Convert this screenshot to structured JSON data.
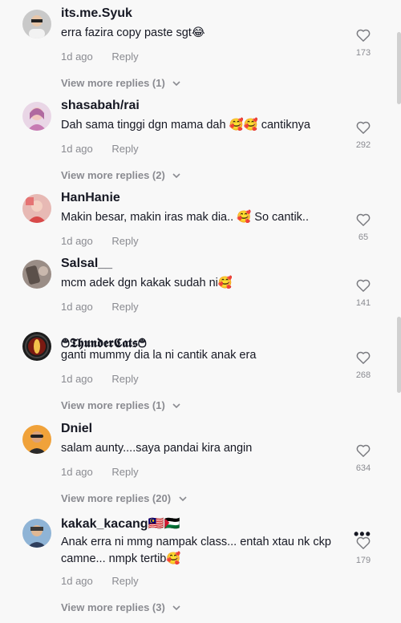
{
  "comments": [
    {
      "username": "its.me.Syuk",
      "text": "erra fazira copy paste sgt😂",
      "time": "1d ago",
      "reply_label": "Reply",
      "likes": "173",
      "view_more": "View more replies (1)"
    },
    {
      "username": "shasabah/rai",
      "text": "Dah sama tinggi dgn mama dah 🥰🥰 cantiknya",
      "time": "1d ago",
      "reply_label": "Reply",
      "likes": "292",
      "view_more": "View more replies (2)"
    },
    {
      "username": "HanHanie",
      "text": "Makin besar, makin iras mak dia.. 🥰 So cantik..",
      "time": "1d ago",
      "reply_label": "Reply",
      "likes": "65",
      "view_more": ""
    },
    {
      "username": "Salsal__",
      "text": "mcm adek dgn kakak sudah ni🥰",
      "time": "1d ago",
      "reply_label": "Reply",
      "likes": "141",
      "view_more": ""
    },
    {
      "username": "࿉𝕿𝖍𝖚𝖓𝖉𝖊𝖗𝕮𝖆𝖙𝖘࿉",
      "text": "ganti mummy dia la ni cantik anak era",
      "time": "1d ago",
      "reply_label": "Reply",
      "likes": "268",
      "view_more": "View more replies (1)"
    },
    {
      "username": "Dniel",
      "text": "salam aunty....saya pandai kira angin",
      "time": "1d ago",
      "reply_label": "Reply",
      "likes": "634",
      "view_more": "View more replies (20)"
    },
    {
      "username": "kakak_kacang🇲🇾🇵🇸",
      "text": "Anak erra ni mmg nampak class... entah xtau nk ckp camne... nmpk tertib🥰",
      "time": "1d ago",
      "reply_label": "Reply",
      "likes": "179",
      "view_more": "View more replies (3)"
    }
  ],
  "icons": {
    "like": "heart-outline-icon",
    "expand": "chevron-down-icon",
    "more": "more-dots-icon"
  },
  "more_dots": "•••",
  "colors": {
    "text": "#161823",
    "muted": "#8a8b91",
    "background": "#f8f8f8"
  }
}
